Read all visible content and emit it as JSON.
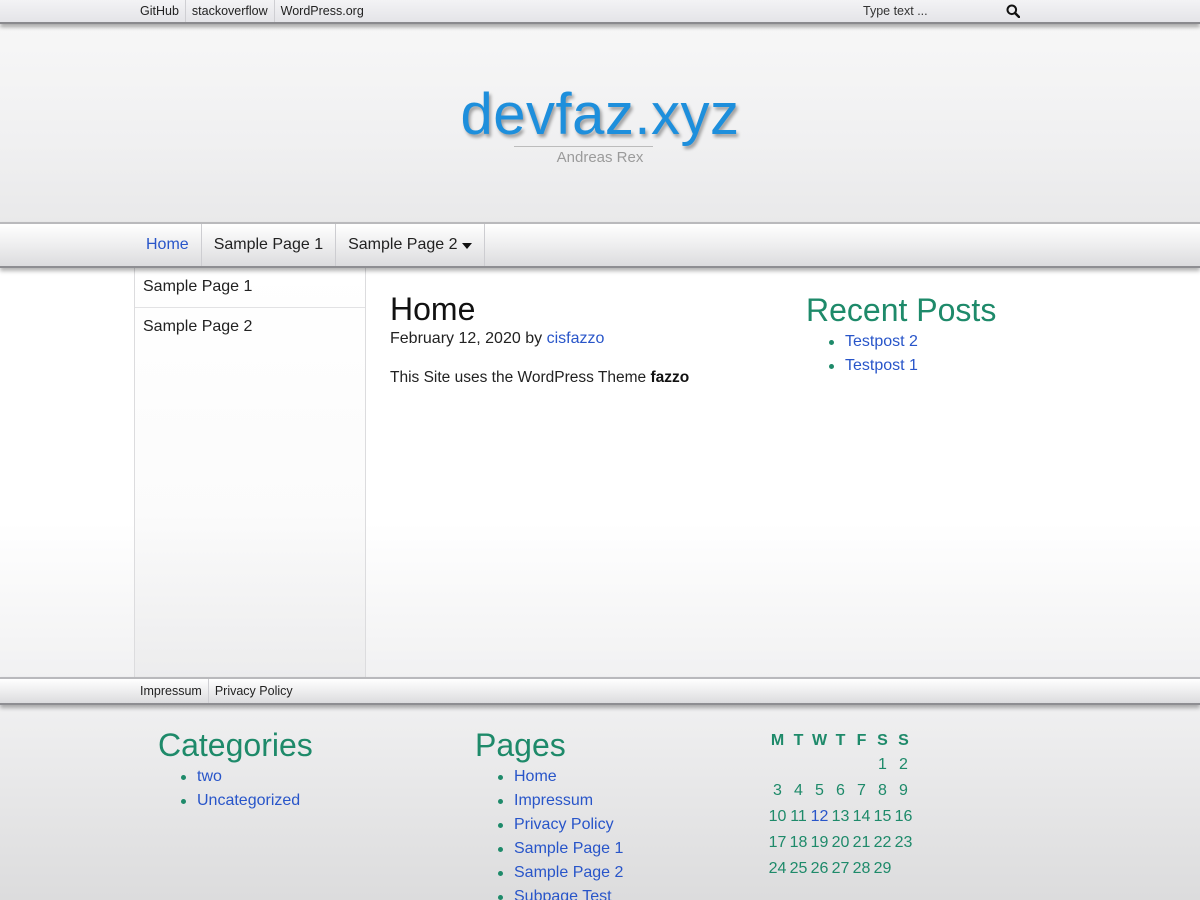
{
  "topbar": {
    "links": [
      "GitHub",
      "stackoverflow",
      "WordPress.org"
    ],
    "search_placeholder": "Type text ...",
    "search_icon": "search-icon"
  },
  "header": {
    "site_title": "devfaz.xyz",
    "tagline": "Andreas Rex"
  },
  "nav": {
    "items": [
      "Home",
      "Sample Page 1",
      "Sample Page 2"
    ],
    "active": "Home",
    "dropdown_icon": "caret-down-icon"
  },
  "sidebar": {
    "items": [
      "Sample Page 1",
      "Sample Page 2"
    ]
  },
  "post": {
    "title": "Home",
    "date": "February 12, 2020",
    "by": "by",
    "author": "cisfazzo",
    "text": "This Site uses the WordPress Theme",
    "theme_name": "fazzo"
  },
  "recent_posts": {
    "heading": "Recent Posts",
    "items": [
      "Testpost 2",
      "Testpost 1"
    ]
  },
  "footer_bar": {
    "links": [
      "Impressum",
      "Privacy Policy"
    ]
  },
  "categories": {
    "heading": "Categories",
    "items": [
      "two",
      "Uncategorized"
    ]
  },
  "pages": {
    "heading": "Pages",
    "items": [
      "Home",
      "Impressum",
      "Privacy Policy",
      "Sample Page 1",
      "Sample Page 2",
      "Subpage Test"
    ]
  },
  "calendar": {
    "weekdays": [
      "M",
      "T",
      "W",
      "T",
      "F",
      "S",
      "S"
    ],
    "weeks": [
      [
        "",
        "",
        "",
        "",
        "",
        "1",
        "2"
      ],
      [
        "3",
        "4",
        "5",
        "6",
        "7",
        "8",
        "9"
      ],
      [
        "10",
        "11",
        "12",
        "13",
        "14",
        "15",
        "16"
      ],
      [
        "17",
        "18",
        "19",
        "20",
        "21",
        "22",
        "23"
      ],
      [
        "24",
        "25",
        "26",
        "27",
        "28",
        "29",
        ""
      ]
    ],
    "linked_day": "12"
  },
  "colors": {
    "title_blue": "#1e8fdc",
    "link_blue": "#2855c9",
    "heading_green": "#1e8a6a"
  }
}
